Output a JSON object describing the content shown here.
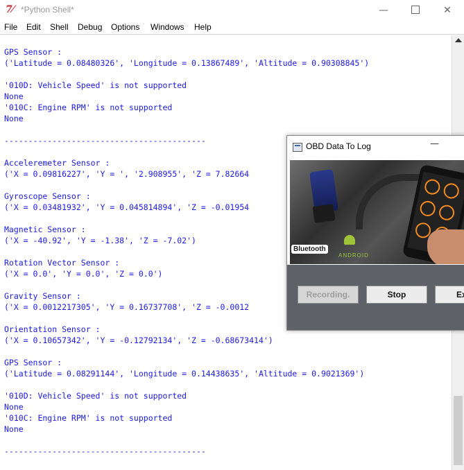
{
  "window": {
    "title": "*Python Shell*",
    "icon_glyph": "7⚖",
    "controls": {
      "minimize": "—",
      "close": "✕"
    }
  },
  "menu": [
    "File",
    "Edit",
    "Shell",
    "Debug",
    "Options",
    "Windows",
    "Help"
  ],
  "shell_lines": [
    "GPS Sensor :",
    "('Latitude = 0.08480326', 'Longitude = 0.13867489', 'Altitude = 0.90308845')",
    "'010D: Vehicle Speed' is not supported",
    "None",
    "'010C: Engine RPM' is not supported",
    "None",
    "------------------------------------------",
    "Acceleremeter Sensor :",
    "('X = 0.09816227', 'Y = ', '2.908955', 'Z = 7.82664",
    "Gyroscope Sensor :",
    "('X = 0.03481932', 'Y = 0.045814894', 'Z = -0.01954",
    "Magnetic Sensor :",
    "('X = -40.92', 'Y = -1.38', 'Z = -7.02')",
    "Rotation Vector Sensor :",
    "('X = 0.0', 'Y = 0.0', 'Z = 0.0')",
    "Gravity Sensor :",
    "('X = 0.0012217305', 'Y = 0.16737708', 'Z = -0.0012",
    "Orientation Sensor :",
    "('X = 0.10657342', 'Y = -0.12792134', 'Z = -0.68673414')",
    "GPS Sensor :",
    "('Latitude = 0.08291144', 'Longitude = 0.14438635', 'Altitude = 0.9021369')",
    "'010D: Vehicle Speed' is not supported",
    "None",
    "'010C: Engine RPM' is not supported",
    "None",
    "------------------------------------------"
  ],
  "obd_dialog": {
    "title": "OBD Data To Log",
    "minimize": "—",
    "banner": {
      "bluetooth": "Bluetooth",
      "android": "ANDROID"
    },
    "buttons": {
      "recording": "Recording.",
      "stop": "Stop",
      "exit": "Ex"
    }
  }
}
